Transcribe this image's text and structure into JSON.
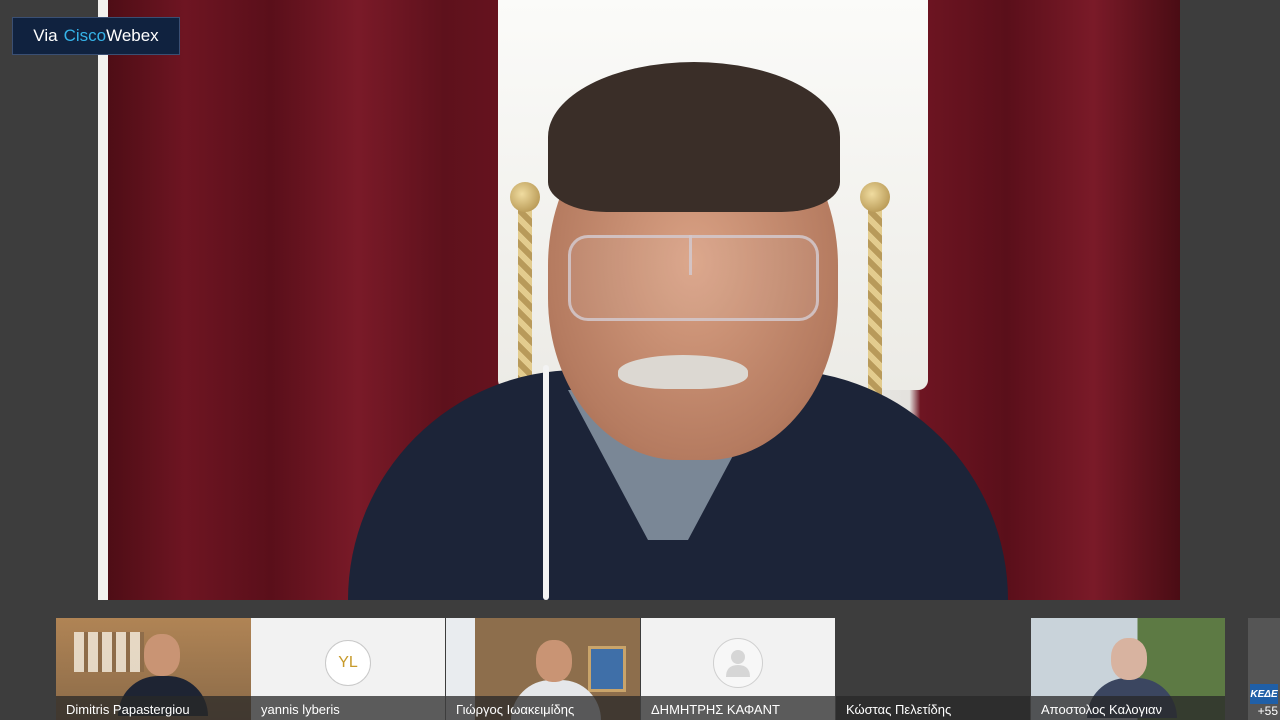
{
  "badge": {
    "prefix": "Via",
    "brand_part1": "Cisco",
    "brand_part2": "Webex"
  },
  "main_video": {
    "icon": "active-speaker-video"
  },
  "participants": [
    {
      "name": "Dimitris Papastergiou",
      "type": "video"
    },
    {
      "name": "yannis lyberis",
      "type": "initials",
      "initials": "YL"
    },
    {
      "name": "Γιώργος Ιωακειμίδης",
      "type": "video"
    },
    {
      "name": "ΔΗΜΗΤΡΗΣ ΚΑΦΑΝΤ",
      "type": "generic-avatar"
    },
    {
      "name": "Κώστας Πελετίδης",
      "type": "blank"
    },
    {
      "name": "Αποστολος Καλογιαν",
      "type": "video"
    }
  ],
  "more": {
    "count": "+55",
    "logo": "ΚΕΔΕ"
  },
  "colors": {
    "badge_bg": "#10223f",
    "brand_accent": "#35b3e8",
    "background": "#3d3d3d"
  }
}
